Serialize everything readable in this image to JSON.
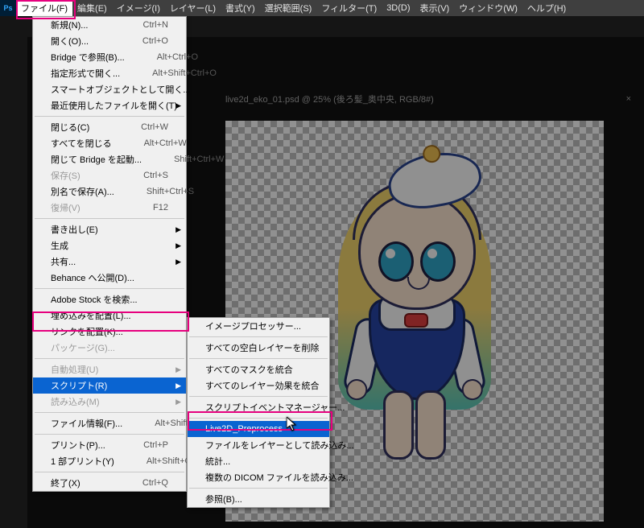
{
  "menubar": {
    "items": [
      "ファイル(F)",
      "編集(E)",
      "イメージ(I)",
      "レイヤー(L)",
      "書式(Y)",
      "選択範囲(S)",
      "フィルター(T)",
      "3D(D)",
      "表示(V)",
      "ウィンドウ(W)",
      "ヘルプ(H)"
    ]
  },
  "document_tab": "live2d_eko_01.psd @ 25% (後ろ髪_奥中央, RGB/8#)",
  "file_menu": [
    {
      "t": "item",
      "label": "新規(N)...",
      "shortcut": "Ctrl+N"
    },
    {
      "t": "item",
      "label": "開く(O)...",
      "shortcut": "Ctrl+O"
    },
    {
      "t": "item",
      "label": "Bridge で参照(B)...",
      "shortcut": "Alt+Ctrl+O"
    },
    {
      "t": "item",
      "label": "指定形式で開く...",
      "shortcut": "Alt+Shift+Ctrl+O"
    },
    {
      "t": "item",
      "label": "スマートオブジェクトとして開く..."
    },
    {
      "t": "sub",
      "label": "最近使用したファイルを開く(T)"
    },
    {
      "t": "sep"
    },
    {
      "t": "item",
      "label": "閉じる(C)",
      "shortcut": "Ctrl+W"
    },
    {
      "t": "item",
      "label": "すべてを閉じる",
      "shortcut": "Alt+Ctrl+W"
    },
    {
      "t": "item",
      "label": "閉じて Bridge を起動...",
      "shortcut": "Shift+Ctrl+W"
    },
    {
      "t": "item",
      "label": "保存(S)",
      "shortcut": "Ctrl+S",
      "disabled": true
    },
    {
      "t": "item",
      "label": "別名で保存(A)...",
      "shortcut": "Shift+Ctrl+S"
    },
    {
      "t": "item",
      "label": "復帰(V)",
      "shortcut": "F12",
      "disabled": true
    },
    {
      "t": "sep"
    },
    {
      "t": "sub",
      "label": "書き出し(E)"
    },
    {
      "t": "sub",
      "label": "生成"
    },
    {
      "t": "sub",
      "label": "共有..."
    },
    {
      "t": "item",
      "label": "Behance へ公開(D)..."
    },
    {
      "t": "sep"
    },
    {
      "t": "item",
      "label": "Adobe Stock を検索..."
    },
    {
      "t": "item",
      "label": "埋め込みを配置(L)..."
    },
    {
      "t": "item",
      "label": "リンクを配置(K)..."
    },
    {
      "t": "item",
      "label": "パッケージ(G)...",
      "disabled": true
    },
    {
      "t": "sep"
    },
    {
      "t": "sub",
      "label": "自動処理(U)",
      "disabled": true
    },
    {
      "t": "sub",
      "label": "スクリプト(R)",
      "selected": true
    },
    {
      "t": "sub",
      "label": "読み込み(M)",
      "disabled": true
    },
    {
      "t": "sep"
    },
    {
      "t": "item",
      "label": "ファイル情報(F)...",
      "shortcut": "Alt+Shift+Ctrl+I"
    },
    {
      "t": "sep"
    },
    {
      "t": "item",
      "label": "プリント(P)...",
      "shortcut": "Ctrl+P"
    },
    {
      "t": "item",
      "label": "1 部プリント(Y)",
      "shortcut": "Alt+Shift+Ctrl+P"
    },
    {
      "t": "sep"
    },
    {
      "t": "item",
      "label": "終了(X)",
      "shortcut": "Ctrl+Q"
    }
  ],
  "script_menu": [
    {
      "t": "item",
      "label": "イメージプロセッサー..."
    },
    {
      "t": "sep"
    },
    {
      "t": "item",
      "label": "すべての空白レイヤーを削除"
    },
    {
      "t": "sep"
    },
    {
      "t": "item",
      "label": "すべてのマスクを統合"
    },
    {
      "t": "item",
      "label": "すべてのレイヤー効果を統合"
    },
    {
      "t": "sep"
    },
    {
      "t": "item",
      "label": "スクリプトイベントマネージャー..."
    },
    {
      "t": "sep"
    },
    {
      "t": "item",
      "label": "Live2D_Preprocess",
      "selected": true
    },
    {
      "t": "item",
      "label": "ファイルをレイヤーとして読み込み..."
    },
    {
      "t": "item",
      "label": "統計..."
    },
    {
      "t": "item",
      "label": "複数の DICOM ファイルを読み込み..."
    },
    {
      "t": "sep"
    },
    {
      "t": "item",
      "label": "参照(B)..."
    }
  ]
}
